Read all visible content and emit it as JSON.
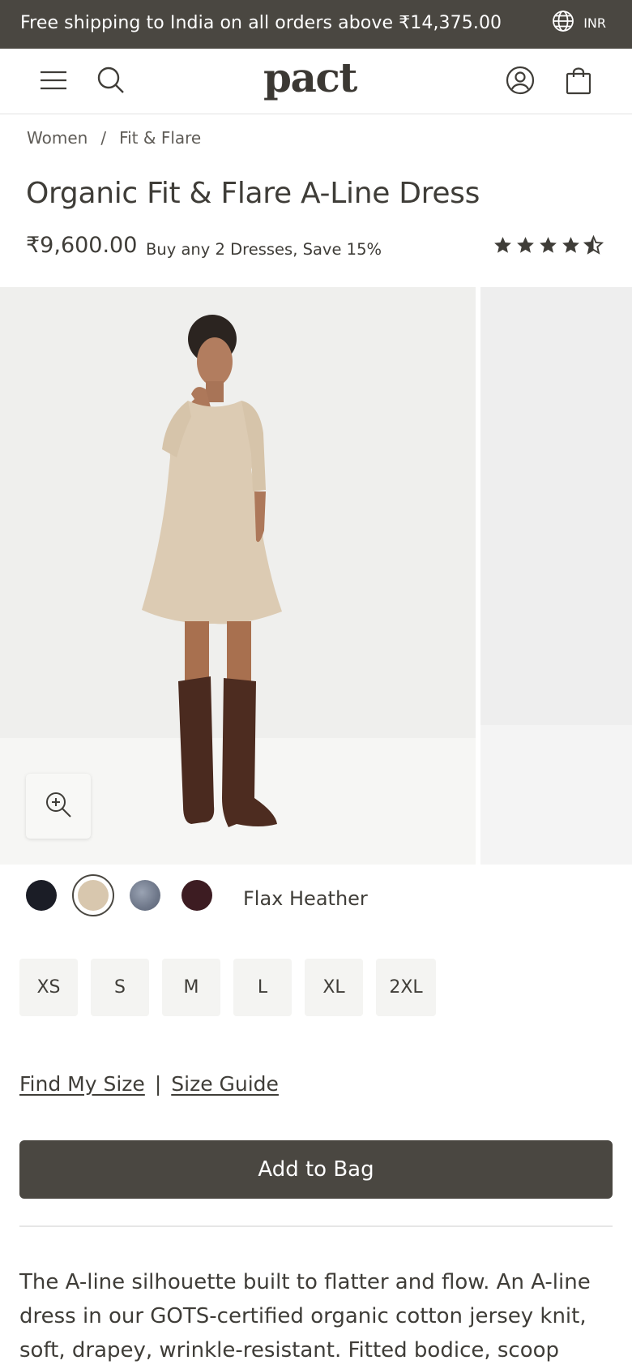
{
  "promo": {
    "text": "Free shipping to India on all orders above ₹14,375.00",
    "currency": "INR"
  },
  "header": {
    "logo": "pact"
  },
  "breadcrumb": {
    "items": [
      "Women",
      "Fit & Flare"
    ],
    "separator": "/"
  },
  "product": {
    "title": "Organic Fit & Flare A-Line Dress",
    "price": "₹9,600.00",
    "promo_note": "Buy any 2 Dresses, Save 15%",
    "rating": 4.5
  },
  "colors": {
    "swatches": [
      {
        "name": "navy",
        "hex": "#1b1d26"
      },
      {
        "name": "flax",
        "hex": "#d8c7ae"
      },
      {
        "name": "blue-heather",
        "hex": "#7b8596"
      },
      {
        "name": "burgundy",
        "hex": "#3d1c22"
      }
    ],
    "selected_index": 1,
    "selected_name": "Flax Heather"
  },
  "sizes": [
    "XS",
    "S",
    "M",
    "L",
    "XL",
    "2XL"
  ],
  "links": {
    "find_size": "Find My Size",
    "separator": "|",
    "size_guide": "Size Guide"
  },
  "cta": {
    "add_to_bag": "Add to Bag"
  },
  "description": "The A-line silhouette built to flatter and flow. An A-line dress in our GOTS-certified organic cotton jersey knit, soft, drapey, wrinkle-resistant. Fitted bodice, scoop",
  "theme": {
    "dark": "#4a4741",
    "text": "#3f3d38"
  }
}
